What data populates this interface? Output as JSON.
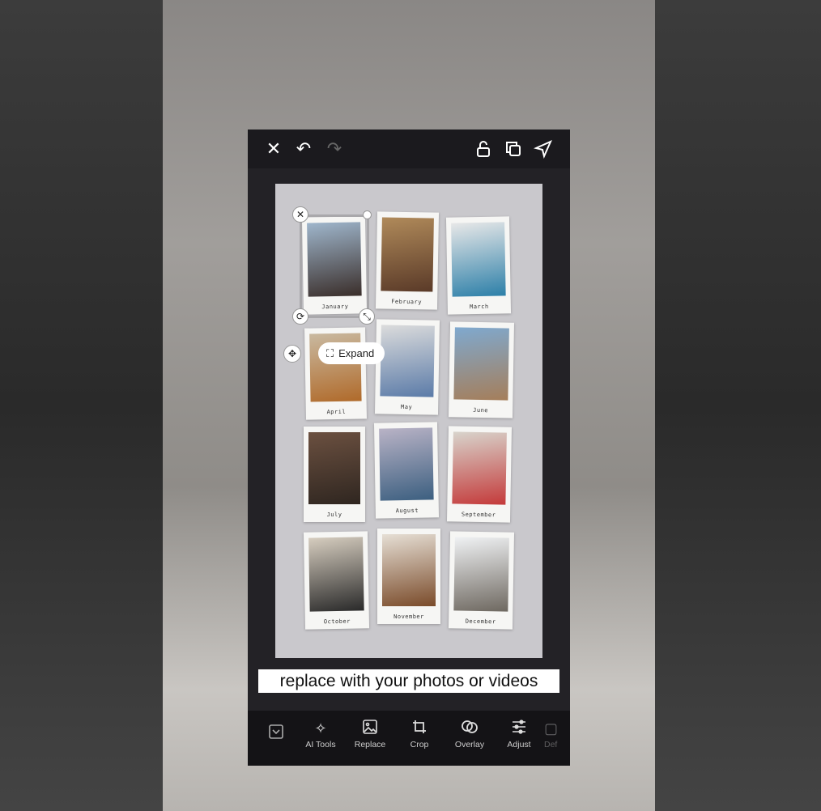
{
  "editor": {
    "top_icons": [
      "close-icon",
      "undo-icon",
      "redo-icon",
      "unlock-icon",
      "duplicate-icon",
      "send-icon"
    ],
    "months": [
      "January",
      "February",
      "March",
      "April",
      "May",
      "June",
      "July",
      "August",
      "September",
      "October",
      "November",
      "December"
    ],
    "expand_label": "Expand",
    "caption": "replace with your photos or videos",
    "tools": [
      {
        "label": "",
        "icon": "collapse-icon"
      },
      {
        "label": "AI Tools",
        "icon": "sparkle-icon"
      },
      {
        "label": "Replace",
        "icon": "image-icon"
      },
      {
        "label": "Crop",
        "icon": "crop-icon"
      },
      {
        "label": "Overlay",
        "icon": "overlay-icon"
      },
      {
        "label": "Adjust",
        "icon": "sliders-icon"
      },
      {
        "label": "Def",
        "icon": "defocus-icon"
      }
    ]
  }
}
